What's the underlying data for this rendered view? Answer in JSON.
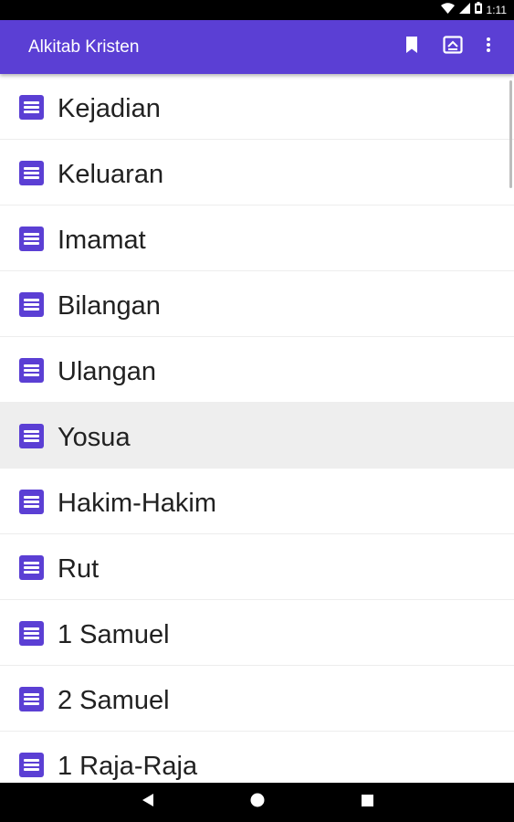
{
  "status_bar": {
    "time": "1:11",
    "icons": [
      "wifi-icon",
      "signal-icon",
      "battery-icon"
    ]
  },
  "app_bar": {
    "title": "Alkitab Kristen",
    "actions": [
      "bookmark-icon",
      "file-export-icon",
      "more-vert-icon"
    ],
    "color": "#5b3fd4"
  },
  "books": [
    {
      "label": "Kejadian",
      "highlighted": false
    },
    {
      "label": "Keluaran",
      "highlighted": false
    },
    {
      "label": "Imamat",
      "highlighted": false
    },
    {
      "label": "Bilangan",
      "highlighted": false
    },
    {
      "label": "Ulangan",
      "highlighted": false
    },
    {
      "label": "Yosua",
      "highlighted": true
    },
    {
      "label": "Hakim-Hakim",
      "highlighted": false
    },
    {
      "label": "Rut",
      "highlighted": false
    },
    {
      "label": "1 Samuel",
      "highlighted": false
    },
    {
      "label": "2 Samuel",
      "highlighted": false
    },
    {
      "label": "1 Raja-Raja",
      "highlighted": false
    }
  ],
  "nav_bar": {
    "buttons": [
      "back-icon",
      "home-icon",
      "recents-icon"
    ]
  }
}
